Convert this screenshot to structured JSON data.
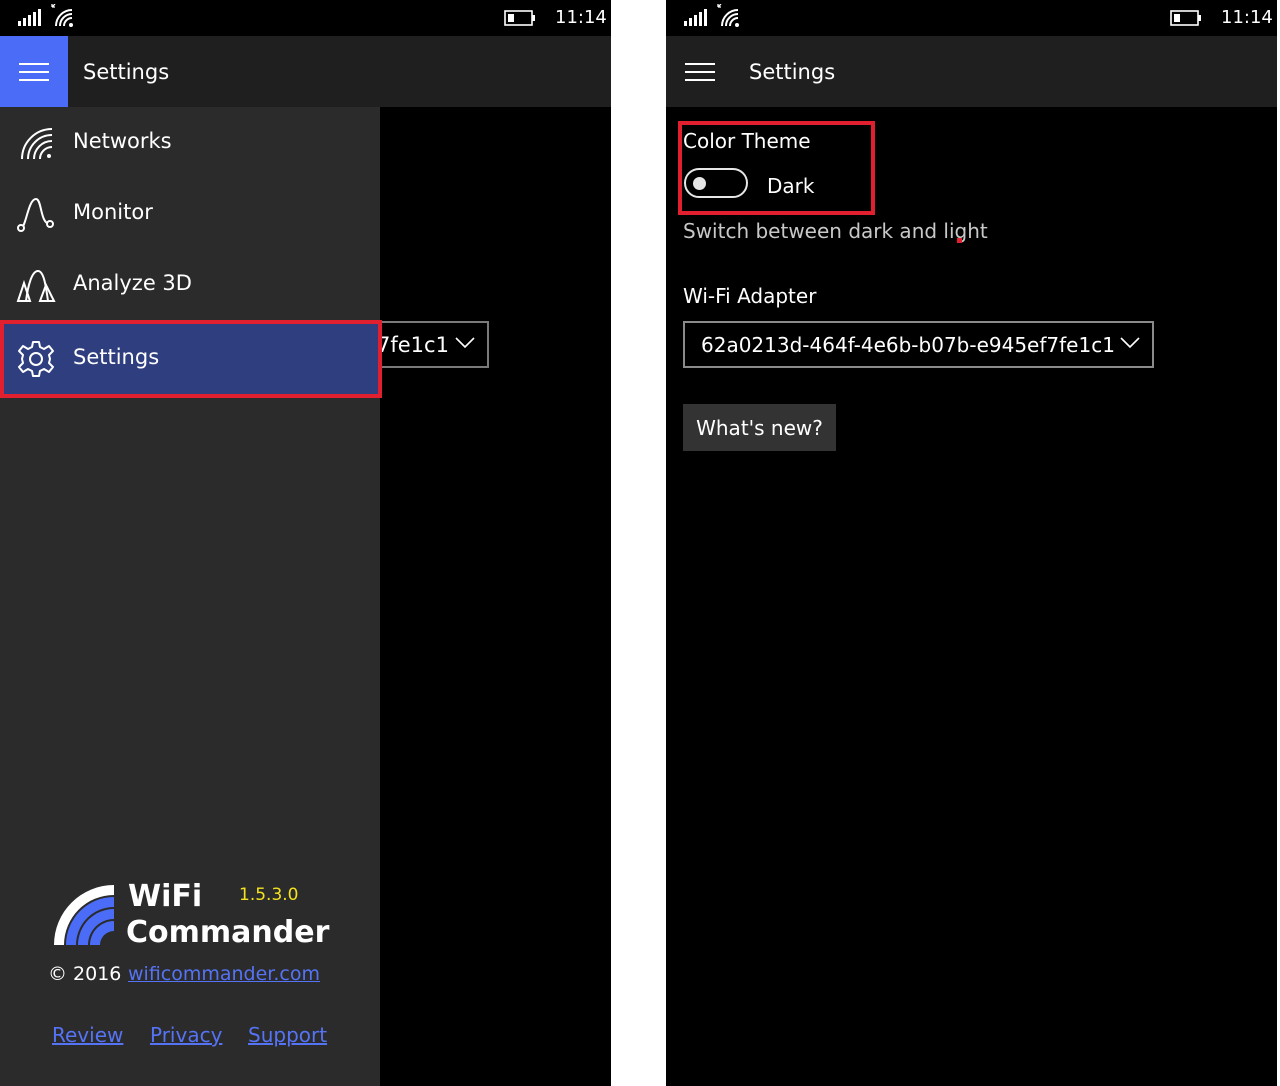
{
  "status": {
    "time": "11:14"
  },
  "left": {
    "title": "Settings",
    "behind_dropdown_value": "7fe1c1",
    "nav": [
      {
        "label": "Networks",
        "icon": "wifi-signal-icon"
      },
      {
        "label": "Monitor",
        "icon": "monitor-graph-icon"
      },
      {
        "label": "Analyze 3D",
        "icon": "analyze-3d-icon"
      },
      {
        "label": "Settings",
        "icon": "gear-icon",
        "selected": true
      }
    ],
    "brand": {
      "line1": "WiFi",
      "line2": "Commander",
      "version": "1.5.3.0"
    },
    "copyright": "© 2016",
    "site_link": "wificommander.com",
    "footer_links": [
      "Review",
      "Privacy",
      "Support"
    ]
  },
  "right": {
    "title": "Settings",
    "color_theme": {
      "label": "Color Theme",
      "state": "Dark",
      "on": false,
      "helper": "Switch between dark and light"
    },
    "adapter": {
      "label": "Wi-Fi Adapter",
      "value": "62a0213d-464f-4e6b-b07b-e945ef7fe1c1"
    },
    "whats_new": "What's new?"
  },
  "colors": {
    "accent": "#4a6cf7",
    "selected": "#2e3e7e",
    "highlight": "#e0202e",
    "link": "#5573f5",
    "version": "#f4e21f"
  }
}
